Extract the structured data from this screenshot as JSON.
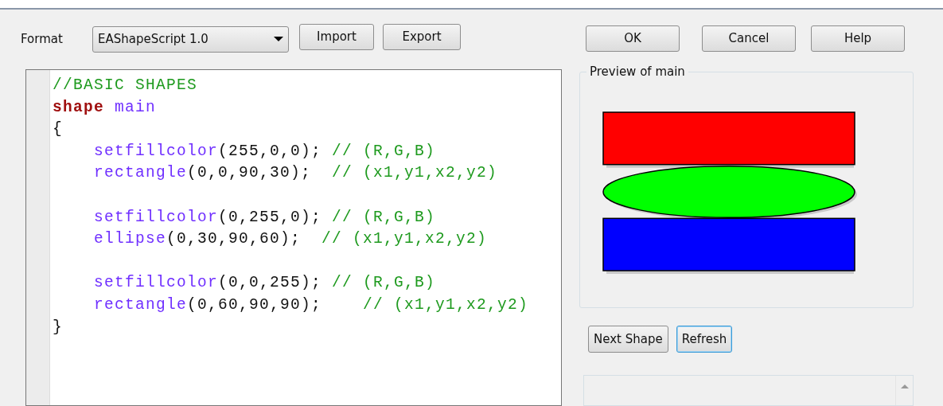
{
  "format": {
    "label": "Format",
    "value": "EAShapeScript 1.0"
  },
  "import_button": "Import",
  "export_button": "Export",
  "dialog_buttons": [
    {
      "label": "OK",
      "focused": false
    },
    {
      "label": "Cancel",
      "focused": false
    },
    {
      "label": "Help",
      "focused": false
    }
  ],
  "editor": {
    "lines": [
      {
        "indent": false,
        "tokens": [
          {
            "kind": "comment",
            "text": "//BASIC SHAPES"
          }
        ]
      },
      {
        "indent": false,
        "tokens": [
          {
            "kind": "keyword",
            "text": "shape"
          },
          {
            "kind": "name",
            "text": "main"
          }
        ]
      },
      {
        "indent": false,
        "tokens": [
          {
            "kind": "plain",
            "text": "{"
          }
        ]
      },
      {
        "indent": true,
        "tokens": [
          {
            "kind": "name",
            "text": "setfillcolor"
          },
          {
            "kind": "plain",
            "text": "(255,0,0);"
          },
          {
            "kind": "comment",
            "text": "// (R,G,B)"
          }
        ]
      },
      {
        "indent": true,
        "tokens": [
          {
            "kind": "name",
            "text": "rectangle"
          },
          {
            "kind": "plain",
            "text": "(0,0,90,30);"
          },
          {
            "kind": "comment",
            "text": " // (x1,y1,x2,y2)"
          }
        ]
      },
      {
        "kind": "blank"
      },
      {
        "indent": true,
        "tokens": [
          {
            "kind": "name",
            "text": "setfillcolor"
          },
          {
            "kind": "plain",
            "text": "(0,255,0);"
          },
          {
            "kind": "comment",
            "text": "// (R,G,B)"
          }
        ]
      },
      {
        "indent": true,
        "tokens": [
          {
            "kind": "name",
            "text": "ellipse"
          },
          {
            "kind": "plain",
            "text": "(0,30,90,60);"
          },
          {
            "kind": "comment",
            "text": " // (x1,y1,x2,y2)"
          }
        ]
      },
      {
        "kind": "blank"
      },
      {
        "indent": true,
        "tokens": [
          {
            "kind": "name",
            "text": "setfillcolor"
          },
          {
            "kind": "plain",
            "text": "(0,0,255);"
          },
          {
            "kind": "comment",
            "text": "// (R,G,B)"
          }
        ]
      },
      {
        "indent": true,
        "tokens": [
          {
            "kind": "name",
            "text": "rectangle"
          },
          {
            "kind": "plain",
            "text": "(0,60,90,90);"
          },
          {
            "kind": "comment",
            "text": "   // (x1,y1,x2,y2)"
          }
        ]
      },
      {
        "indent": false,
        "tokens": [
          {
            "kind": "plain",
            "text": "}"
          }
        ]
      }
    ]
  },
  "preview": {
    "title": "Preview of main",
    "shapes": [
      {
        "kind": "rectangle",
        "color": "#ff0000"
      },
      {
        "kind": "ellipse",
        "color": "#00ff00"
      },
      {
        "kind": "rectangle",
        "color": "#0000ff"
      }
    ]
  },
  "shape_buttons": [
    {
      "label": "Next Shape",
      "focused": false
    },
    {
      "label": "Refresh",
      "focused": true
    }
  ]
}
